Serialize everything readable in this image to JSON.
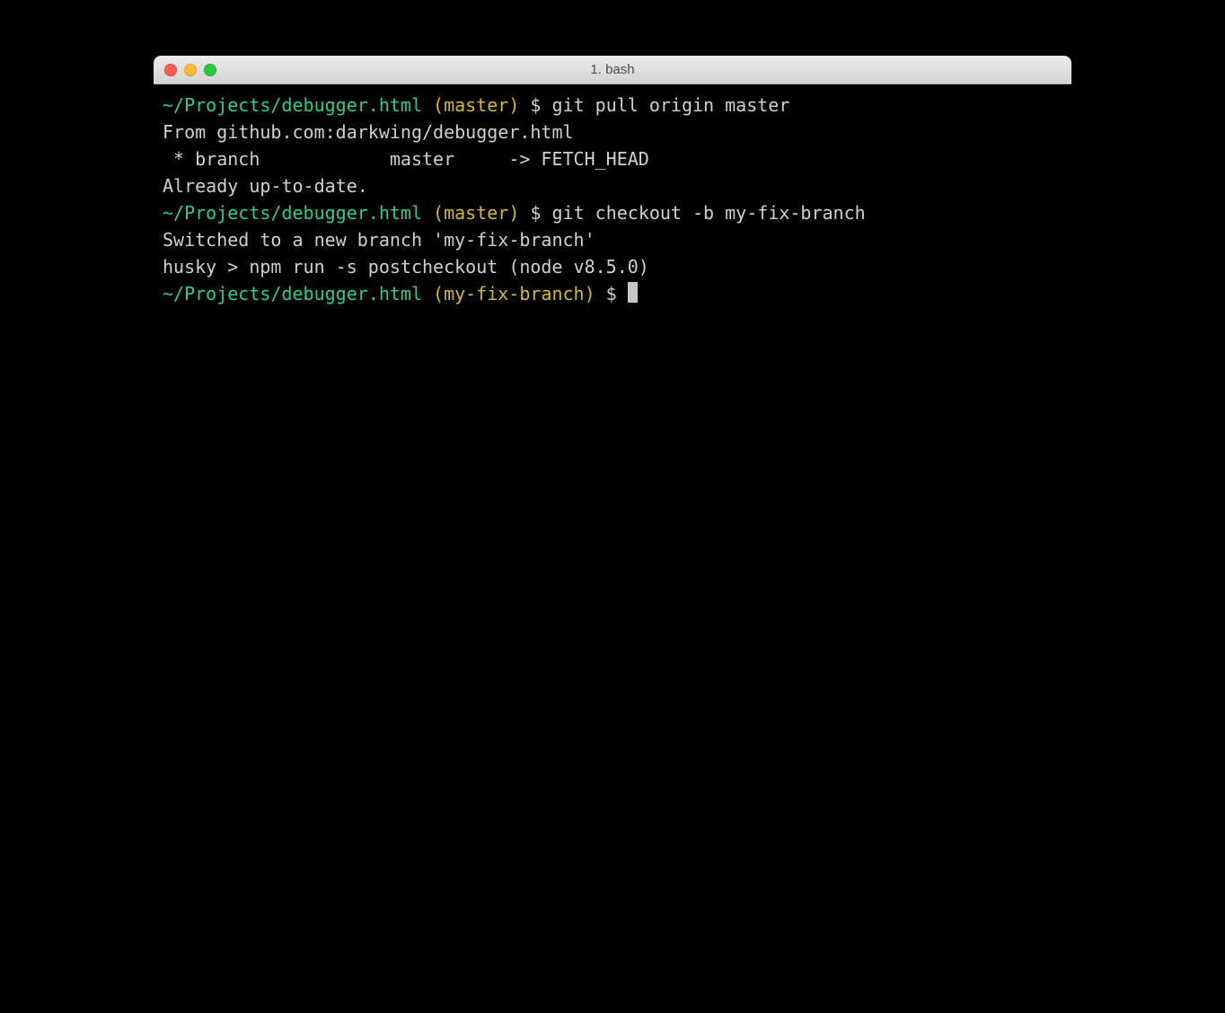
{
  "window": {
    "title": "1. bash"
  },
  "lines": {
    "l0_path": "~/Projects/debugger.html",
    "l0_branch": " (master)",
    "l0_dollar": " $ ",
    "l0_cmd": "git pull origin master",
    "l1": "From github.com:darkwing/debugger.html",
    "l2": " * branch            master     -> FETCH_HEAD",
    "l3": "Already up-to-date.",
    "l4_path": "~/Projects/debugger.html",
    "l4_branch": " (master)",
    "l4_dollar": " $ ",
    "l4_cmd": "git checkout -b my-fix-branch",
    "l5": "Switched to a new branch 'my-fix-branch'",
    "l6": "husky > npm run -s postcheckout (node v8.5.0)",
    "l7": "",
    "l8_path": "~/Projects/debugger.html",
    "l8_branch": " (my-fix-branch)",
    "l8_dollar": " $ "
  }
}
